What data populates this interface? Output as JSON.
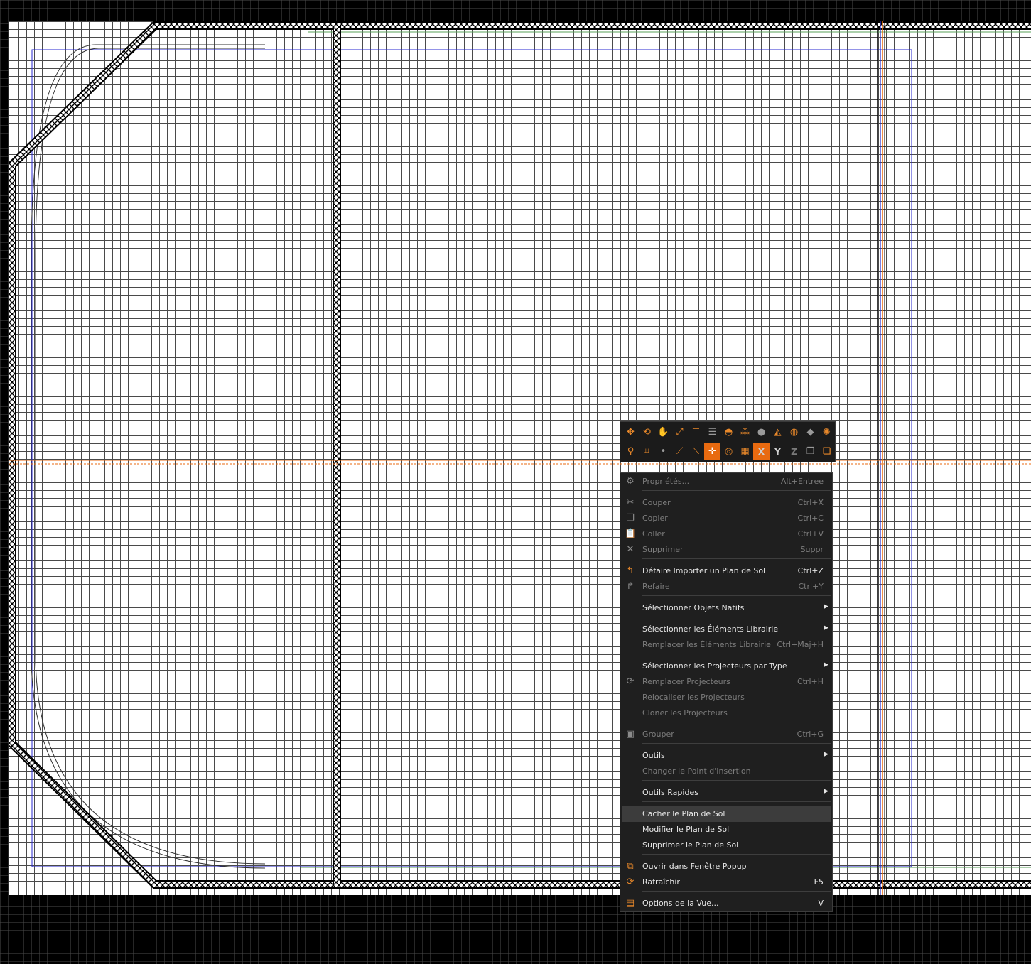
{
  "colors": {
    "background": "#000000",
    "plan_background": "#ffffff",
    "grid_line": "#4a4a4a",
    "accent_orange": "#e86a10",
    "menu_background": "#1f1f1f",
    "menu_text": "#e6e6e6",
    "menu_text_disabled": "#7c7c7c",
    "guide_blue": "#2a2ad0"
  },
  "toolbar": {
    "row1": [
      {
        "icon": "move-icon"
      },
      {
        "icon": "rotate-icon"
      },
      {
        "icon": "pan-icon"
      },
      {
        "icon": "scale-icon"
      },
      {
        "icon": "snap-icon"
      },
      {
        "icon": "list-icon"
      },
      {
        "icon": "sphere-half-icon"
      },
      {
        "icon": "group-objects-icon"
      },
      {
        "icon": "sphere-icon"
      },
      {
        "icon": "cone-icon"
      },
      {
        "icon": "globe-icon"
      },
      {
        "icon": "shape-icon"
      },
      {
        "icon": "burst-icon"
      }
    ],
    "row2": [
      {
        "icon": "focus-icon"
      },
      {
        "icon": "crop-icon"
      },
      {
        "icon": "point-icon"
      },
      {
        "icon": "line-icon"
      },
      {
        "icon": "edge-icon"
      },
      {
        "icon": "center-icon",
        "active": true
      },
      {
        "icon": "target-icon"
      },
      {
        "icon": "pattern-icon"
      },
      {
        "icon": "axis-x-icon",
        "label": "X",
        "active": true
      },
      {
        "icon": "axis-y-icon",
        "label": "Y"
      },
      {
        "icon": "axis-z-icon",
        "label": "Z"
      },
      {
        "icon": "layers-icon"
      },
      {
        "icon": "layers-alt-icon"
      }
    ]
  },
  "menu": {
    "items": [
      {
        "label": "Propriétés...",
        "shortcut": "Alt+Entree",
        "disabled": true,
        "icon": "properties-icon"
      },
      {
        "label": "Couper",
        "shortcut": "Ctrl+X",
        "disabled": true,
        "icon": "cut-icon"
      },
      {
        "label": "Copier",
        "shortcut": "Ctrl+C",
        "disabled": true,
        "icon": "copy-icon"
      },
      {
        "label": "Coller",
        "shortcut": "Ctrl+V",
        "disabled": true,
        "icon": "paste-icon"
      },
      {
        "label": "Supprimer",
        "shortcut": "Suppr",
        "disabled": true,
        "icon": "delete-icon"
      },
      {
        "label": "Défaire Importer un Plan de Sol",
        "shortcut": "Ctrl+Z",
        "disabled": false,
        "icon": "undo-icon"
      },
      {
        "label": "Refaire",
        "shortcut": "Ctrl+Y",
        "disabled": true,
        "icon": "redo-icon"
      },
      {
        "label": "Sélectionner Objets Natifs",
        "shortcut": "",
        "disabled": false,
        "submenu": true
      },
      {
        "label": "Sélectionner les Éléments Librairie",
        "shortcut": "",
        "disabled": false,
        "submenu": true
      },
      {
        "label": "Remplacer les Éléments Librairie",
        "shortcut": "Ctrl+Maj+H",
        "disabled": true
      },
      {
        "label": "Sélectionner les Projecteurs par Type",
        "shortcut": "",
        "disabled": false,
        "submenu": true
      },
      {
        "label": "Remplacer Projecteurs",
        "shortcut": "Ctrl+H",
        "disabled": true,
        "icon": "replace-icon"
      },
      {
        "label": "Relocaliser les Projecteurs",
        "shortcut": "",
        "disabled": true
      },
      {
        "label": "Cloner les Projecteurs",
        "shortcut": "",
        "disabled": true
      },
      {
        "label": "Grouper",
        "shortcut": "Ctrl+G",
        "disabled": true,
        "icon": "group-icon"
      },
      {
        "label": "Outils",
        "shortcut": "",
        "disabled": false,
        "submenu": true
      },
      {
        "label": "Changer le Point d'Insertion",
        "shortcut": "",
        "disabled": true
      },
      {
        "label": "Outils Rapides",
        "shortcut": "",
        "disabled": false,
        "submenu": true
      },
      {
        "label": "Cacher le Plan de Sol",
        "shortcut": "",
        "disabled": false,
        "hover": true
      },
      {
        "label": "Modifier le Plan de Sol",
        "shortcut": "",
        "disabled": false
      },
      {
        "label": "Supprimer le Plan de Sol",
        "shortcut": "",
        "disabled": false
      },
      {
        "label": "Ouvrir dans Fenêtre Popup",
        "shortcut": "",
        "disabled": false,
        "icon": "popup-window-icon"
      },
      {
        "label": "Rafraîchir",
        "shortcut": "F5",
        "disabled": false,
        "icon": "refresh-icon"
      },
      {
        "label": "Options de la Vue...",
        "shortcut": "V",
        "disabled": false,
        "icon": "view-options-icon"
      }
    ]
  }
}
